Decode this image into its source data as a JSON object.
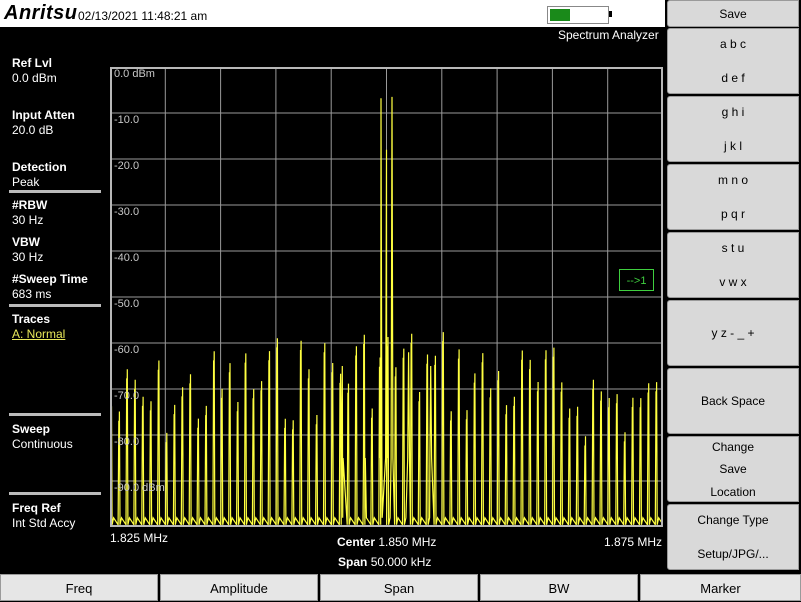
{
  "header": {
    "brand": "Anritsu",
    "datetime": "02/13/2021 11:48:21 am",
    "mode": "Spectrum Analyzer",
    "battery_level": 0.35,
    "battery_color": "#1a8a1a"
  },
  "left_panel": {
    "ref_lvl": {
      "name": "Ref Lvl",
      "value": "0.0 dBm"
    },
    "input_atten": {
      "name": "Input Atten",
      "value": "20.0 dB"
    },
    "detection": {
      "name": "Detection",
      "value": "Peak"
    },
    "rbw": {
      "name": "#RBW",
      "value": "30 Hz"
    },
    "vbw": {
      "name": "VBW",
      "value": "30 Hz"
    },
    "sweep_time": {
      "name": "#Sweep Time",
      "value": "683 ms"
    },
    "traces": {
      "name": "Traces",
      "value": "A: Normal"
    },
    "sweep": {
      "name": "Sweep",
      "value": "Continuous"
    },
    "freq_ref": {
      "name": "Freq Ref",
      "value": "Int Std Accy"
    }
  },
  "plot": {
    "y_labels": [
      "0.0 dBm",
      "-10.0",
      "-20.0",
      "-30.0",
      "-40.0",
      "-50.0",
      "-60.0",
      "-70.0",
      "-80.0",
      "-90.0 dBm"
    ],
    "marker_indicator": "-->1",
    "trace_color": "#ffff40"
  },
  "chart_data": {
    "type": "line",
    "ylim": [
      -100,
      0
    ],
    "xlim": [
      1.825,
      1.875
    ],
    "x_unit": "MHz",
    "y_unit": "dBm",
    "grid": true,
    "peaks": [
      {
        "x": 1.8495,
        "y": -6.8
      },
      {
        "x": 1.8505,
        "y": -6.5
      },
      {
        "x": 1.85,
        "y": -18
      },
      {
        "x": 1.848,
        "y": -60
      },
      {
        "x": 1.852,
        "y": -62
      },
      {
        "x": 1.846,
        "y": -65
      },
      {
        "x": 1.854,
        "y": -65
      }
    ]
  },
  "axis": {
    "start": "1.825 MHz",
    "stop": "1.875 MHz",
    "center_label": "Center",
    "center_value": "1.850 MHz",
    "span_label": "Span",
    "span_value": "50.000 kHz"
  },
  "softkeys": [
    {
      "lines": [
        "Save"
      ]
    },
    {
      "lines": [
        "a b c",
        "d e f"
      ]
    },
    {
      "lines": [
        "g h i",
        "j k l"
      ]
    },
    {
      "lines": [
        "m n o",
        "p q r"
      ]
    },
    {
      "lines": [
        "s t u",
        "v w x"
      ]
    },
    {
      "lines": [
        "y z - _ +"
      ]
    },
    {
      "lines": [
        "Back Space"
      ]
    },
    {
      "lines": [
        "Change",
        "Save",
        "Location"
      ]
    },
    {
      "lines": [
        "Change Type",
        "Setup/JPG/..."
      ]
    }
  ],
  "bottom_menu": [
    "Freq",
    "Amplitude",
    "Span",
    "BW",
    "Marker"
  ]
}
